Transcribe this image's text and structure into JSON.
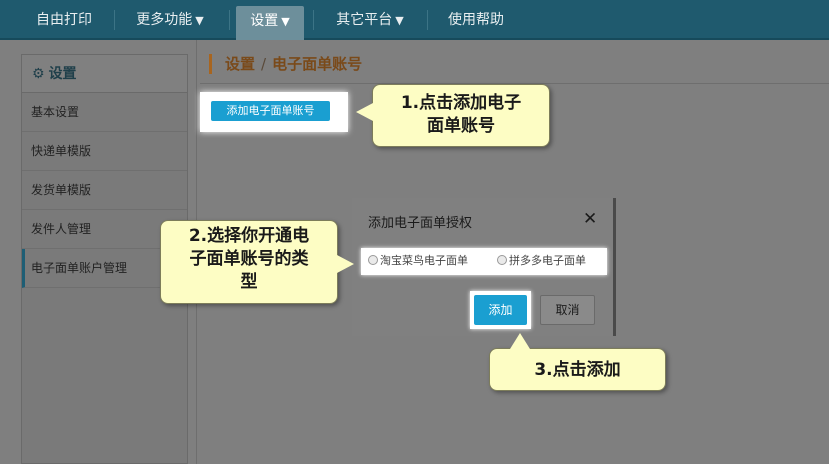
{
  "nav": {
    "items": [
      {
        "label": "自由打印",
        "caret": ""
      },
      {
        "label": "更多功能",
        "caret": "▼"
      },
      {
        "label": "设置",
        "caret": "▼"
      },
      {
        "label": "其它平台",
        "caret": "▼"
      },
      {
        "label": "使用帮助",
        "caret": ""
      }
    ],
    "active_index": 2
  },
  "sidebar": {
    "header": "设置",
    "header_icon": "gear-icon",
    "items": [
      {
        "label": "基本设置"
      },
      {
        "label": "快递单模版"
      },
      {
        "label": "发货单模版"
      },
      {
        "label": "发件人管理"
      },
      {
        "label": "电子面单账户管理"
      }
    ],
    "active_index": 4
  },
  "breadcrumb": {
    "root": "设置",
    "separator": "/",
    "current": "电子面单账号"
  },
  "main": {
    "add_button_label": "添加电子面单账号"
  },
  "dialog": {
    "title": "添加电子面单授权",
    "close_glyph": "✕",
    "options": [
      {
        "label": "淘宝菜鸟电子面单"
      },
      {
        "label": "拼多多电子面单"
      }
    ],
    "confirm_label": "添加",
    "cancel_label": "取消"
  },
  "callouts": {
    "step1_line1": "1.点击添加电子",
    "step1_line2": "面单账号",
    "step2_line1": "2.选择你开通电",
    "step2_line2": "子面单账号的类",
    "step2_line3": "型",
    "step3": "3.点击添加"
  },
  "colors": {
    "nav_bg": "#1f5a6e",
    "accent_blue": "#1a9fd1",
    "callout_bg": "#fdfdc4",
    "breadcrumb_bar": "#a8651f"
  }
}
